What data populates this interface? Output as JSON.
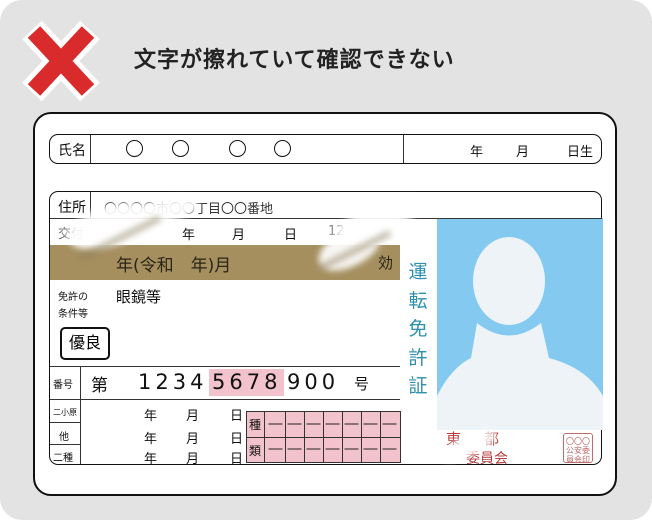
{
  "headline": "文字が擦れていて確認できない",
  "card": {
    "name_label": "氏名",
    "name_value_mark": "〇",
    "birth_year": "年",
    "birth_month": "月",
    "birth_day": "日生",
    "address_label": "住所",
    "address_value": "〇〇〇〇市〇〇丁目〇〇番地",
    "issue_label": "交付",
    "issue_year": "年",
    "issue_month": "月",
    "issue_day": "日",
    "issue_number": "12",
    "expiry_text": "年(令和　年)月",
    "expiry_tail": "効",
    "conditions_label_1": "免許の",
    "conditions_label_2": "条件等",
    "conditions_value": "眼鏡等",
    "excellent_badge": "優良",
    "number_label": "番号",
    "number_prefix": "第",
    "number_part1": "1234",
    "number_part2": "5678",
    "number_part3": "900",
    "number_suffix": "号",
    "license_rows": [
      "二小原",
      "他",
      "二種"
    ],
    "date_year": "年",
    "date_month": "月",
    "date_day": "日",
    "category_label_1": "種",
    "category_label_2": "類",
    "vertical_title": [
      "運",
      "転",
      "免",
      "許",
      "証"
    ],
    "issuer_part1": "東",
    "issuer_part2": "都",
    "issuer_committee": "委員会",
    "seal_text": "〇〇〇公安委員会印",
    "cell_mark": "―"
  },
  "colors": {
    "background": "#e3e3e3",
    "x_mark": "#d92b2b",
    "photo_background": "#84c9ef",
    "silhouette": "#eef3f7",
    "gold_band": "#a58f5f",
    "pink_highlight": "#f2c3cc",
    "accent_text": "#2f8fb0",
    "seal_red": "#c06a6a"
  },
  "icons": [
    "x-mark-icon",
    "person-silhouette-icon"
  ]
}
